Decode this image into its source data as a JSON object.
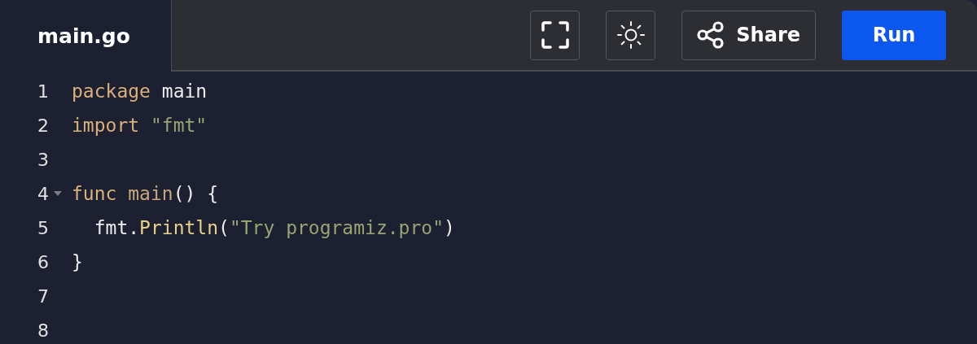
{
  "tab": {
    "label": "main.go",
    "selected": true
  },
  "toolbar": {
    "buttons": [
      {
        "kind": "fullscreen"
      },
      {
        "kind": "theme"
      },
      {
        "kind": "share",
        "label": "Share"
      },
      {
        "kind": "run",
        "label": "Run"
      }
    ]
  },
  "code_lines": [
    {
      "number": "1",
      "foldable": false,
      "tokens": [
        {
          "kind": "keyword",
          "text": "package"
        },
        {
          "kind": "plain",
          "text": " main"
        }
      ]
    },
    {
      "number": "2",
      "foldable": false,
      "tokens": [
        {
          "kind": "keyword",
          "text": "import"
        },
        {
          "kind": "string",
          "text": " \"fmt\""
        }
      ]
    },
    {
      "number": "3",
      "foldable": false
    },
    {
      "number": "4",
      "foldable": true,
      "tokens": [
        {
          "kind": "keyword",
          "text": "func"
        },
        {
          "kind": "name",
          "text": " main"
        },
        {
          "kind": "plain",
          "text": "() {"
        }
      ]
    },
    {
      "number": "5",
      "foldable": false,
      "tokens": [
        {
          "kind": "plain",
          "text": "  fmt."
        },
        {
          "kind": "function",
          "text": "Println"
        },
        {
          "kind": "plain",
          "text": "("
        },
        {
          "kind": "string",
          "text": "\"Try programiz.pro\""
        },
        {
          "kind": "plain",
          "text": ")"
        }
      ]
    },
    {
      "number": "6",
      "foldable": false,
      "tokens": [
        {
          "kind": "plain",
          "text": "}"
        }
      ]
    },
    {
      "number": "7",
      "foldable": false
    },
    {
      "number": "8",
      "foldable": false
    }
  ]
}
